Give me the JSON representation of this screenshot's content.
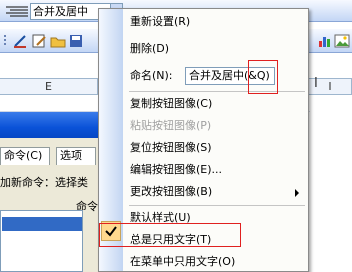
{
  "toolbar": {
    "merge_combo_value": "合并及居中"
  },
  "sheet": {
    "columns": [
      "E",
      "I"
    ]
  },
  "dialog": {
    "tabs": [
      "命令(C)",
      "选项"
    ],
    "add_command_text": "加新命令：选择类",
    "commands_label": "命令"
  },
  "context_menu": {
    "items": [
      {
        "label": "重新设置(R)",
        "enabled": true
      },
      {
        "label": "删除(D)",
        "enabled": true
      },
      {
        "label": "复制按钮图像(C)",
        "enabled": true
      },
      {
        "label": "粘贴按钮图像(P)",
        "enabled": false
      },
      {
        "label": "复位按钮图像(S)",
        "enabled": true
      },
      {
        "label": "编辑按钮图像(E)...",
        "enabled": true
      },
      {
        "label": "更改按钮图像(B)",
        "enabled": true
      },
      {
        "label": "默认样式(U)",
        "enabled": true
      },
      {
        "label": "总是只用文字(T)",
        "enabled": true,
        "checked": true
      },
      {
        "label": "在菜单中只用文字(O)",
        "enabled": true
      }
    ],
    "name_label": "命名(N):",
    "name_value": "合并及居中(&Q)"
  }
}
